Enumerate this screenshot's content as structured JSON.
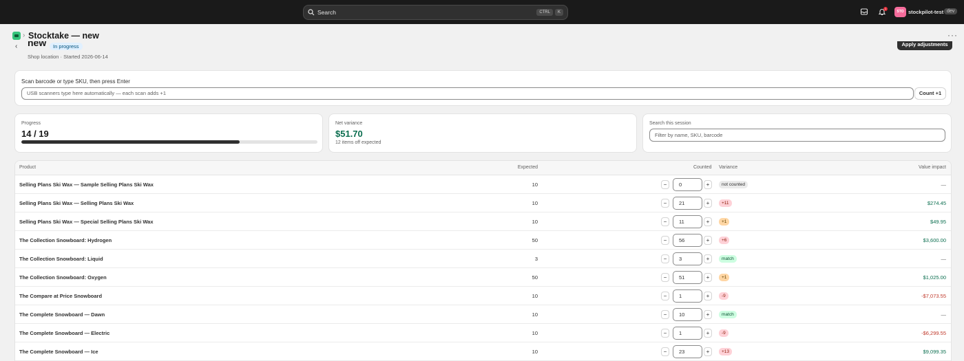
{
  "topbar": {
    "search_label": "Search",
    "shortcut_ctrl": "CTRL",
    "shortcut_key": "K",
    "notification_count": "1",
    "avatar_initials": "STO",
    "store_name": "stockpilot-test",
    "env_badge": "dev"
  },
  "breadcrumb": {
    "title": "Stocktake — new",
    "more": "···"
  },
  "header": {
    "back": "‹",
    "title": "new",
    "status": "In progress",
    "subtitle": "Shop location · Started 2026-06-14",
    "apply_button": "Apply adjustments"
  },
  "scan": {
    "label": "Scan barcode or type SKU, then press Enter",
    "placeholder": "USB scanners type here automatically — each scan adds +1",
    "button": "Count +1"
  },
  "progress": {
    "label": "Progress",
    "value": "14 / 19",
    "fraction": 0.737
  },
  "net_variance": {
    "label": "Net variance",
    "value": "$51.70",
    "sub": "12 items off expected"
  },
  "filter": {
    "label": "Search this session",
    "placeholder": "Filter by name, SKU, barcode"
  },
  "table": {
    "headers": {
      "product": "Product",
      "expected": "Expected",
      "counted": "Counted",
      "variance": "Variance",
      "value_impact": "Value impact"
    },
    "rows": [
      {
        "product": "Selling Plans Ski Wax — Sample Selling Plans Ski Wax",
        "expected": "10",
        "counted": "0",
        "variance": "not counted",
        "variance_type": "neutral",
        "impact": "—",
        "impact_type": "none"
      },
      {
        "product": "Selling Plans Ski Wax — Selling Plans Ski Wax",
        "expected": "10",
        "counted": "21",
        "variance": "+11",
        "variance_type": "over-high",
        "impact": "$274.45",
        "impact_type": "pos"
      },
      {
        "product": "Selling Plans Ski Wax — Special Selling Plans Ski Wax",
        "expected": "10",
        "counted": "11",
        "variance": "+1",
        "variance_type": "over-low",
        "impact": "$49.95",
        "impact_type": "pos"
      },
      {
        "product": "The Collection Snowboard: Hydrogen",
        "expected": "50",
        "counted": "56",
        "variance": "+6",
        "variance_type": "over-high",
        "impact": "$3,600.00",
        "impact_type": "pos"
      },
      {
        "product": "The Collection Snowboard: Liquid",
        "expected": "3",
        "counted": "3",
        "variance": "match",
        "variance_type": "match",
        "impact": "—",
        "impact_type": "none"
      },
      {
        "product": "The Collection Snowboard: Oxygen",
        "expected": "50",
        "counted": "51",
        "variance": "+1",
        "variance_type": "over-low",
        "impact": "$1,025.00",
        "impact_type": "pos"
      },
      {
        "product": "The Compare at Price Snowboard",
        "expected": "10",
        "counted": "1",
        "variance": "-9",
        "variance_type": "under",
        "impact": "-$7,073.55",
        "impact_type": "neg"
      },
      {
        "product": "The Complete Snowboard — Dawn",
        "expected": "10",
        "counted": "10",
        "variance": "match",
        "variance_type": "match",
        "impact": "—",
        "impact_type": "none"
      },
      {
        "product": "The Complete Snowboard — Electric",
        "expected": "10",
        "counted": "1",
        "variance": "-9",
        "variance_type": "under",
        "impact": "-$6,299.55",
        "impact_type": "neg"
      },
      {
        "product": "The Complete Snowboard — Ice",
        "expected": "10",
        "counted": "23",
        "variance": "+13",
        "variance_type": "over-high",
        "impact": "$9,099.35",
        "impact_type": "pos"
      }
    ],
    "minus": "−",
    "plus": "+"
  }
}
